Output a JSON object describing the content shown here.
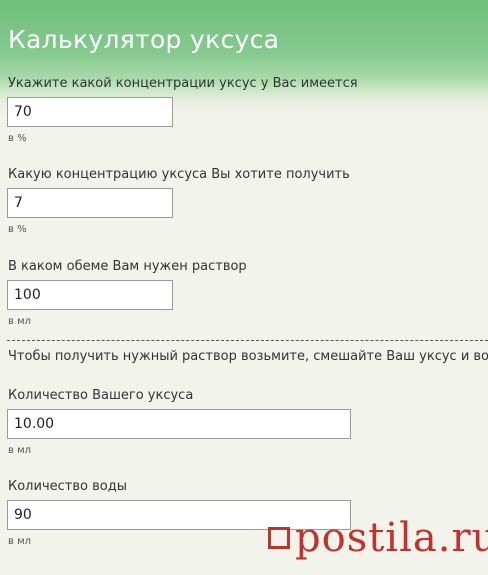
{
  "header": {
    "title": "Калькулятор уксуса"
  },
  "fields": [
    {
      "label": "Укажите какой концентрации уксус у Вас имеется",
      "value": "70",
      "unit": "в %"
    },
    {
      "label": "Какую концентрацию уксуса Вы хотите получить",
      "value": "7",
      "unit": "в %"
    },
    {
      "label": "В каком обеме Вам нужен раствор",
      "value": "100",
      "unit": "в мл"
    }
  ],
  "result_intro": "Чтобы получить нужный раствор возьмите, смешайте Ваш уксус и воду",
  "results": [
    {
      "label": "Количество Вашего уксуса",
      "value": "10.00",
      "unit": "в мл"
    },
    {
      "label": "Количество воды",
      "value": "90",
      "unit": "в мл"
    }
  ],
  "watermark": {
    "text": "postila.ru"
  },
  "colors": {
    "header_green": "#7cc487",
    "watermark_red": "#c0322f",
    "background": "#f2f3ea"
  }
}
